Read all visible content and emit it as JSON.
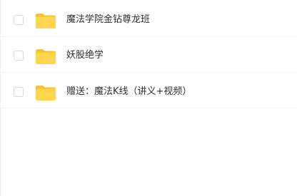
{
  "file_list": {
    "items": [
      {
        "name": "魔法学院金钻尊龙班",
        "type": "folder",
        "icon": "folder-icon",
        "checked": false
      },
      {
        "name": "妖股绝学",
        "type": "folder",
        "icon": "folder-icon",
        "checked": false
      },
      {
        "name": "赠送：魔法K线（讲义+视频）",
        "type": "folder",
        "icon": "folder-icon",
        "checked": false
      }
    ]
  },
  "colors": {
    "folder": "#FFD54F",
    "folder_tab": "#F5C338",
    "text": "#2B2F36",
    "divider": "#F1F2F4",
    "checkbox_border": "#D6D9DE"
  }
}
